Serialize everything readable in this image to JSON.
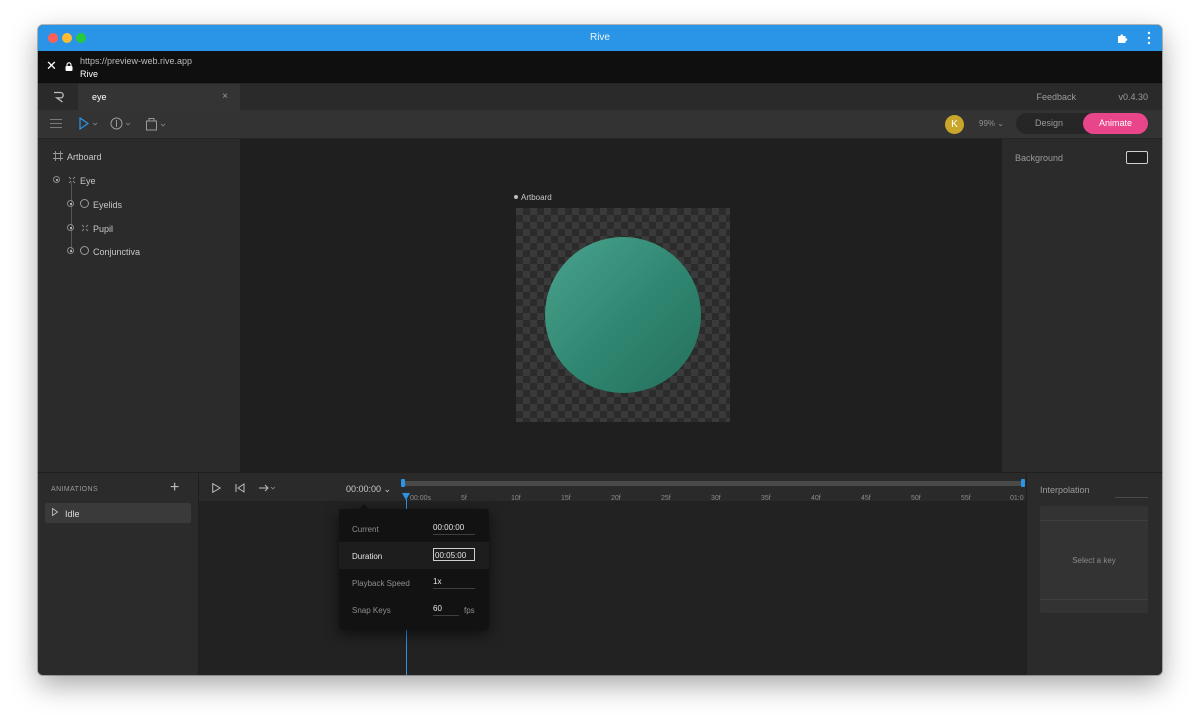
{
  "window": {
    "title": "Rive"
  },
  "browser": {
    "url": "https://preview-web.rive.app",
    "site_name": "Rive",
    "close_symbol": "✕"
  },
  "tabs": {
    "items": [
      {
        "label": "eye",
        "close": "×"
      }
    ]
  },
  "header": {
    "feedback_label": "Feedback",
    "version": "v0.4.30"
  },
  "toolbar": {
    "avatar_initial": "K",
    "zoom_label": "99%",
    "mode_design_label": "Design",
    "mode_animate_label": "Animate",
    "accent_color": "#e9458a"
  },
  "hierarchy": {
    "items": [
      {
        "label": "Artboard",
        "icon": "artboard-icon"
      },
      {
        "label": "Eye",
        "icon": "group-icon"
      },
      {
        "label": "Eyelids",
        "icon": "ellipse-icon"
      },
      {
        "label": "Pupil",
        "icon": "group-icon"
      },
      {
        "label": "Conjunctiva",
        "icon": "ellipse-icon"
      }
    ]
  },
  "stage": {
    "artboard_label": "Artboard",
    "eye_color": "#2f8670"
  },
  "inspector": {
    "background_label": "Background"
  },
  "animations": {
    "title": "ANIMATIONS",
    "add_symbol": "+",
    "items": [
      {
        "label": "Idle"
      }
    ]
  },
  "timeline": {
    "time": "00:00:00",
    "ruler": [
      "00:00s",
      "5f",
      "10f",
      "15f",
      "20f",
      "25f",
      "30f",
      "35f",
      "40f",
      "45f",
      "50f",
      "55f",
      "01:0"
    ],
    "playhead_color": "#2a95e7"
  },
  "popover": {
    "current_label": "Current",
    "current_value": "00:00:00",
    "duration_label": "Duration",
    "duration_value": "00:05:00",
    "speed_label": "Playback Speed",
    "speed_value": "1x",
    "snap_label": "Snap Keys",
    "snap_value": "60",
    "snap_unit": "fps"
  },
  "interpolation": {
    "title": "Interpolation",
    "hint": "Select a key"
  }
}
